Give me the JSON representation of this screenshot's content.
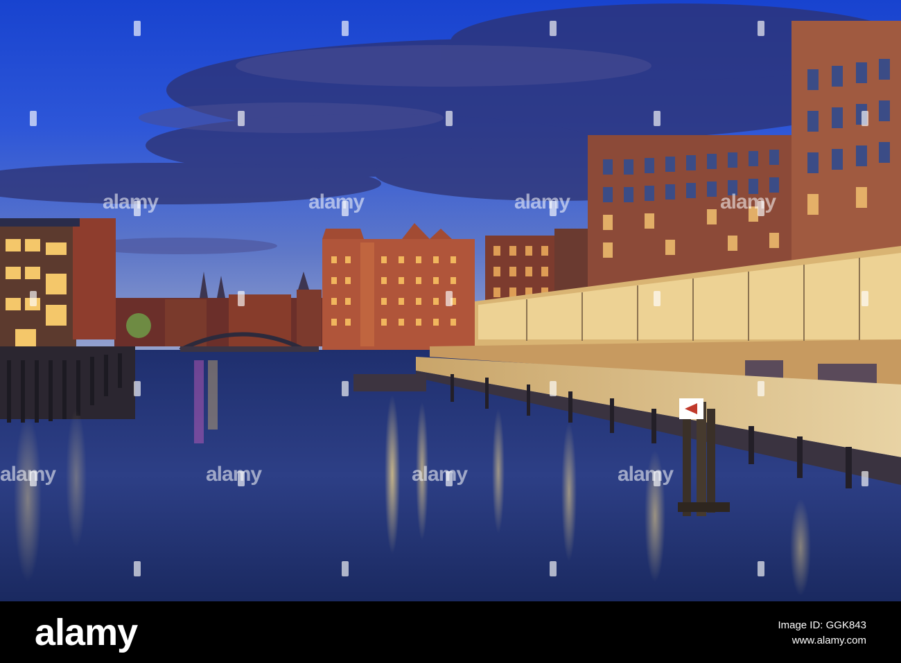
{
  "image": {
    "alt": "",
    "sky_top": "#1a4fd6",
    "sky_low": "#7a8cc8",
    "cloud": "#3b3f7a",
    "water": "#2a3c7e",
    "brick": "#a04a2e",
    "light": "#ffd070"
  },
  "watermark": {
    "text": "alamy"
  },
  "footer": {
    "brand": "alamy",
    "image_id_label": "Image ID: GGK843",
    "site": "www.alamy.com"
  }
}
